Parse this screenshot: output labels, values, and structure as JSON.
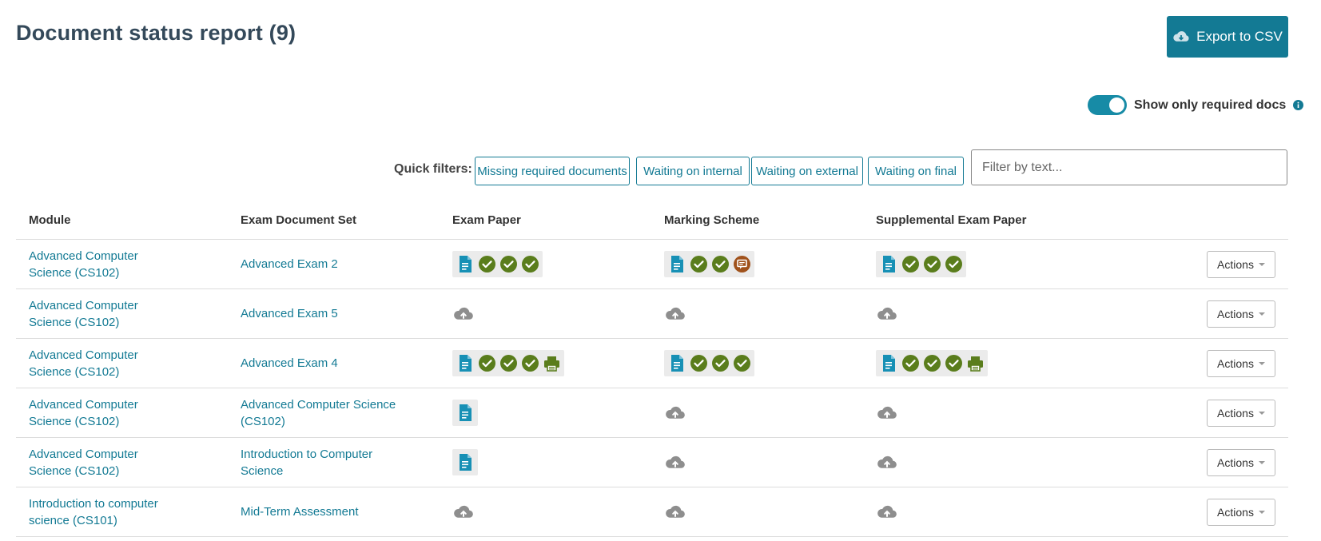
{
  "header": {
    "title": "Document status report (9)",
    "export_label": "Export to CSV"
  },
  "toggle": {
    "label": "Show only required docs",
    "on": true
  },
  "filters": {
    "quick_label": "Quick filters:",
    "buttons": [
      "Missing required documents",
      "Waiting on internal",
      "Waiting on external",
      "Waiting on final"
    ],
    "search_placeholder": "Filter by text..."
  },
  "table": {
    "columns": [
      "Module",
      "Exam Document Set",
      "Exam Paper",
      "Marking Scheme",
      "Supplemental Exam Paper"
    ],
    "actions_label": "Actions",
    "rows": [
      {
        "module": "Advanced Computer Science (CS102)",
        "set": "Advanced Exam 2",
        "paper": [
          "doc-icon",
          "check-icon",
          "check-icon",
          "check-icon"
        ],
        "scheme": [
          "doc-icon",
          "check-icon",
          "check-icon",
          "comment-icon"
        ],
        "supp": [
          "doc-icon",
          "check-icon",
          "check-icon",
          "check-icon"
        ]
      },
      {
        "module": "Advanced Computer Science (CS102)",
        "set": "Advanced Exam 5",
        "paper": [
          "upload-icon"
        ],
        "scheme": [
          "upload-icon"
        ],
        "supp": [
          "upload-icon"
        ]
      },
      {
        "module": "Advanced Computer Science (CS102)",
        "set": "Advanced Exam 4",
        "paper": [
          "doc-icon",
          "check-icon",
          "check-icon",
          "check-icon",
          "print-icon"
        ],
        "scheme": [
          "doc-icon",
          "check-icon",
          "check-icon",
          "check-icon"
        ],
        "supp": [
          "doc-icon",
          "check-icon",
          "check-icon",
          "check-icon",
          "print-icon"
        ]
      },
      {
        "module": "Advanced Computer Science (CS102)",
        "set": "Advanced Computer Science (CS102)",
        "paper": [
          "doc-icon"
        ],
        "scheme": [
          "upload-icon"
        ],
        "supp": [
          "upload-icon"
        ]
      },
      {
        "module": "Advanced Computer Science (CS102)",
        "set": "Introduction to Computer Science",
        "paper": [
          "doc-icon"
        ],
        "scheme": [
          "upload-icon"
        ],
        "supp": [
          "upload-icon"
        ]
      },
      {
        "module": "Introduction to computer science (CS101)",
        "set": "Mid-Term Assessment",
        "paper": [
          "upload-icon"
        ],
        "scheme": [
          "upload-icon"
        ],
        "supp": [
          "upload-icon"
        ]
      }
    ]
  },
  "colors": {
    "accent": "#137a94",
    "check": "#5a7d1c",
    "comment": "#a0521c",
    "doc": "#1790b5",
    "upload": "#8e8e8e"
  }
}
